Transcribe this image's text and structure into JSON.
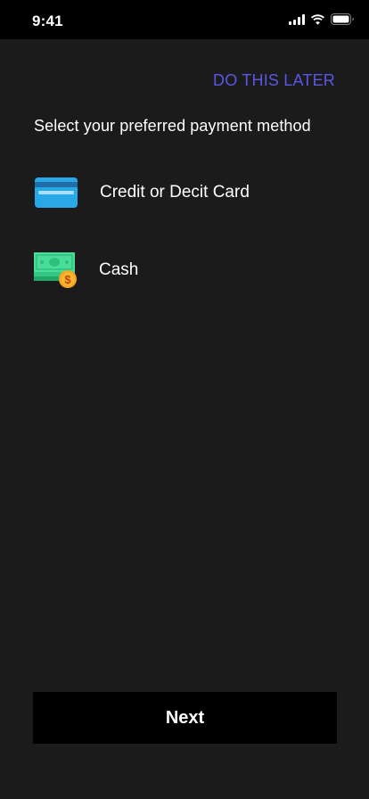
{
  "status_bar": {
    "time": "9:41"
  },
  "header": {
    "skip_label": "DO THIS LATER"
  },
  "main": {
    "heading": "Select your preferred payment method",
    "options": [
      {
        "label": "Credit or Decit Card",
        "icon": "credit-card-icon"
      },
      {
        "label": "Cash",
        "icon": "cash-icon",
        "badge": "$"
      }
    ]
  },
  "footer": {
    "next_label": "Next"
  },
  "colors": {
    "background": "#1b1b1b",
    "accent": "#5b57e6",
    "card_blue": "#29a8e8",
    "cash_green": "#3ecf8e",
    "coin_orange": "#f5a623"
  }
}
